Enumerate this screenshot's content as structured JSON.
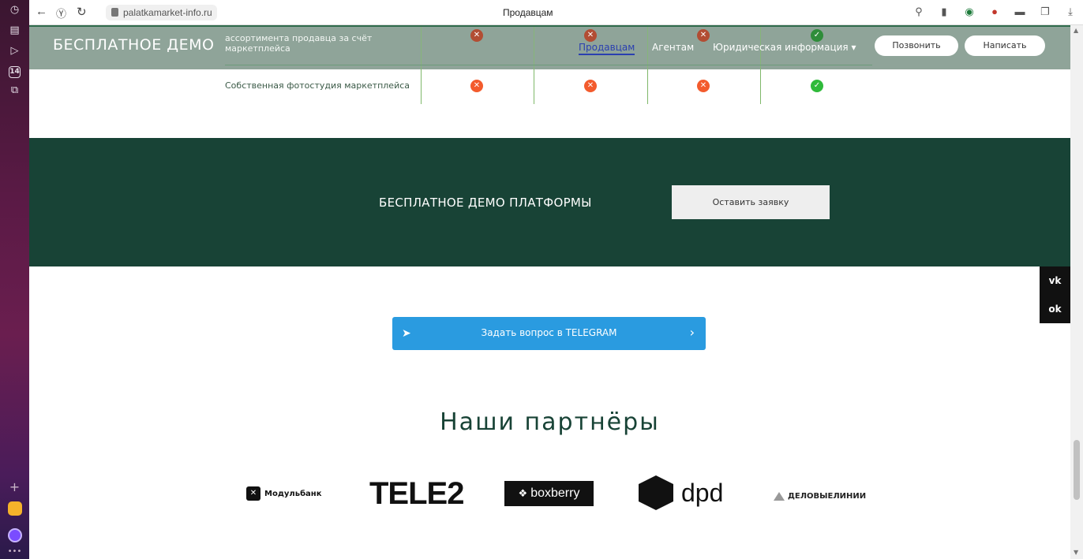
{
  "browser": {
    "url": "palatkamarket-info.ru",
    "tab_title": "Продавцам"
  },
  "header": {
    "logo": "БЕСПЛАТНОЕ ДЕМО",
    "row_text": "ассортимента продавца за счёт маркетплейса",
    "nav": [
      "Продавцам",
      "Агентам",
      "Юридическая информация ▾"
    ],
    "call_button": "Позвонить",
    "write_button": "Написать"
  },
  "table": {
    "row_label": "Собственная фотостудия маркетплейса",
    "values": [
      "no",
      "no",
      "no",
      "yes"
    ]
  },
  "demo": {
    "title": "БЕСПЛАТНОЕ ДЕМО ПЛАТФОРМЫ",
    "button": "Оставить заявку"
  },
  "social": [
    "vk",
    "ok"
  ],
  "telegram": {
    "label": "Задать вопрос в TELEGRAM"
  },
  "partners": {
    "title": "Наши партнёры",
    "logos": [
      "Модульбанк",
      "TELE2",
      "boxberry",
      "dpd",
      "ДЕЛОВЫЕЛИНИИ"
    ]
  }
}
